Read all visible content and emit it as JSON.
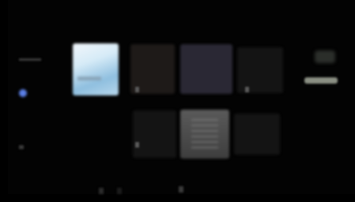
{
  "app": {
    "header_title": "",
    "sidebar": {
      "items": [
        {
          "name": "sidebar-item-1"
        },
        {
          "name": "sidebar-item-active"
        },
        {
          "name": "sidebar-item-3"
        },
        {
          "name": "sidebar-item-4"
        }
      ]
    },
    "tiles_row_1": [
      {
        "name": "tile-light"
      },
      {
        "name": "tile-brown"
      },
      {
        "name": "tile-purple"
      },
      {
        "name": "tile-dark"
      }
    ],
    "tiles_row_2": [
      {
        "name": "tile-dark-1"
      },
      {
        "name": "tile-document"
      },
      {
        "name": "tile-dark-2"
      }
    ],
    "colors": {
      "accent_blue": "#5b7fe6",
      "button_gray": "#8a8f83"
    },
    "icons": {
      "active_dot": "circle-icon",
      "tile_icons": [
        "small-rect-icon",
        "small-rect-icon",
        "small-rect-icon"
      ]
    }
  }
}
